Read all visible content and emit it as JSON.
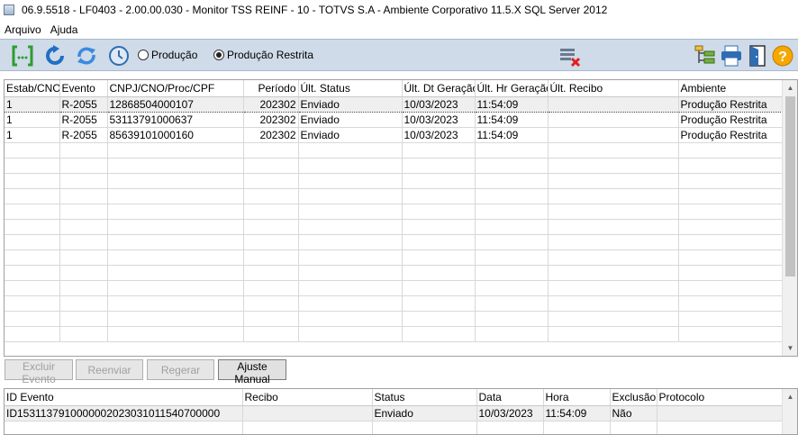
{
  "window": {
    "title": "06.9.5518 - LF0403 - 2.00.00.030 - Monitor TSS REINF - 10 - TOTVS S.A - Ambiente Corporativo 11.5.X SQL Server 2012"
  },
  "menu": {
    "arquivo": "Arquivo",
    "ajuda": "Ajuda"
  },
  "toolbar": {
    "icons": [
      "parameters-icon",
      "refresh-icon",
      "sync-icon",
      "schedule-icon",
      "delete-filter-icon",
      "tree-icon",
      "print-icon",
      "exit-icon",
      "help-icon"
    ],
    "env_options": [
      {
        "label": "Produção",
        "checked": false
      },
      {
        "label": "Produção Restrita",
        "checked": true
      }
    ]
  },
  "events_grid": {
    "columns": [
      "Estab/CNO",
      "Evento",
      "CNPJ/CNO/Proc/CPF",
      "Período",
      "Últ. Status",
      "Últ. Dt Geração",
      "Últ. Hr Geração",
      "Últ. Recibo",
      "Ambiente"
    ],
    "rows": [
      {
        "estab": "1",
        "evento": "R-2055",
        "cnpj": "12868504000107",
        "periodo": "202302",
        "status": "Enviado",
        "dt": "10/03/2023",
        "hr": "11:54:09",
        "recibo": "",
        "ambiente": "Produção Restrita",
        "selected": true
      },
      {
        "estab": "1",
        "evento": "R-2055",
        "cnpj": "53113791000637",
        "periodo": "202302",
        "status": "Enviado",
        "dt": "10/03/2023",
        "hr": "11:54:09",
        "recibo": "",
        "ambiente": "Produção Restrita",
        "selected": false
      },
      {
        "estab": "1",
        "evento": "R-2055",
        "cnpj": "85639101000160",
        "periodo": "202302",
        "status": "Enviado",
        "dt": "10/03/2023",
        "hr": "11:54:09",
        "recibo": "",
        "ambiente": "Produção Restrita",
        "selected": false
      }
    ]
  },
  "actions": {
    "excluir": "Excluir Evento",
    "reenviar": "Reenviar",
    "regerar": "Regerar",
    "ajuste": "Ajuste Manual"
  },
  "history_grid": {
    "columns": [
      "ID Evento",
      "Recibo",
      "Status",
      "Data",
      "Hora",
      "Exclusão",
      "Protocolo"
    ],
    "rows": [
      {
        "id": "ID1531137910000002023031011540700000",
        "recibo": "",
        "status": "Enviado",
        "data": "10/03/2023",
        "hora": "11:54:09",
        "exclusao": "Não",
        "protocolo": ""
      }
    ]
  }
}
